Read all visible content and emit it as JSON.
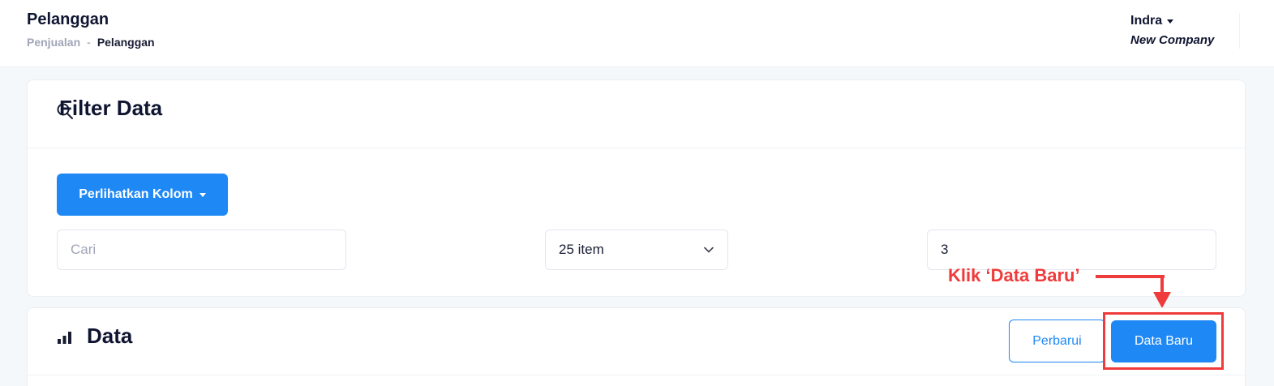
{
  "header": {
    "title": "Pelanggan",
    "breadcrumb": {
      "parent": "Penjualan",
      "separator": "-",
      "current": "Pelanggan"
    },
    "user": {
      "name": "Indra",
      "company": "New Company"
    }
  },
  "filter_card": {
    "title": "Filter Data",
    "icon": "search-icon",
    "column_button_label": "Perlihatkan Kolom",
    "search_placeholder": "Cari",
    "search_value": "",
    "per_page_selected": "25 item",
    "page_value": "3"
  },
  "annotation": {
    "text": "Klik ‘Data Baru’",
    "color": "#ef3b3b"
  },
  "data_card": {
    "title": "Data",
    "icon": "bar-chart-icon",
    "refresh_label": "Perbarui",
    "new_label": "Data Baru"
  },
  "colors": {
    "primary": "#1e88f5",
    "title": "#0f1530",
    "muted": "#a1a5b7"
  }
}
